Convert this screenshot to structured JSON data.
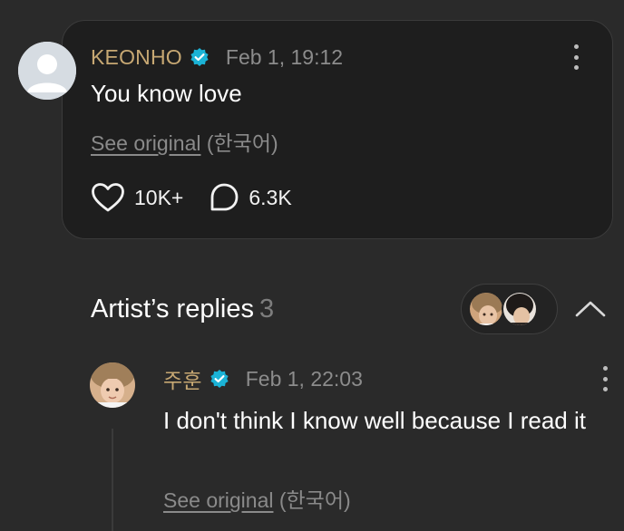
{
  "post": {
    "author": "KEONHO",
    "timestamp": "Feb 1, 19:12",
    "text": "You know love",
    "see_original": "See original",
    "original_lang": " (한국어)",
    "likes": "10K+",
    "comments": "6.3K"
  },
  "artist_replies": {
    "title": "Artist’s replies",
    "count": "3"
  },
  "reply": {
    "author": "주훈",
    "timestamp": "Feb 1, 22:03",
    "text": "I don't think I know well because I read it",
    "see_original": "See original",
    "original_lang": " (한국어)"
  },
  "colors": {
    "artist_name": "#c7a873",
    "verified_badge": "#1bb3d6",
    "background": "#2a2a2a",
    "card": "#1e1e1e"
  },
  "icons": [
    "verified-check-icon",
    "heart-icon",
    "comment-bubble-icon",
    "more-vertical-icon",
    "chevron-up-icon"
  ]
}
